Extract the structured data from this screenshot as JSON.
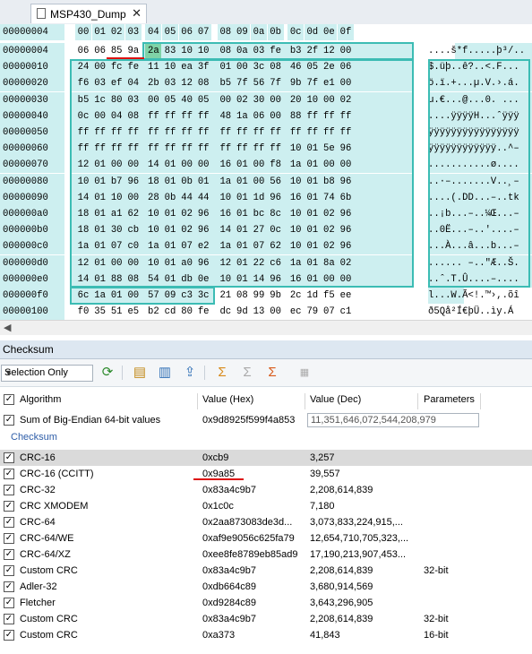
{
  "tab": {
    "title": "MSP430_Dump",
    "close": "✕"
  },
  "hex": {
    "header_offset": "00000004",
    "columns": [
      "00",
      "01",
      "02",
      "03",
      "04",
      "05",
      "06",
      "07",
      "08",
      "09",
      "0a",
      "0b",
      "0c",
      "0d",
      "0e",
      "0f"
    ],
    "rows": [
      {
        "offset": "00000004",
        "bytes": [
          "06",
          "06",
          "85",
          "9a",
          "2a",
          "83",
          "10",
          "10",
          "08",
          "0a",
          "03",
          "fe",
          "b3",
          "2f",
          "12",
          "00"
        ],
        "ascii": "....š*f.....þ³/.."
      },
      {
        "offset": "00000010",
        "bytes": [
          "24",
          "00",
          "fc",
          "fe",
          "11",
          "10",
          "ea",
          "3f",
          "01",
          "00",
          "3c",
          "08",
          "46",
          "05",
          "2e",
          "06"
        ],
        "ascii": "$.üþ..ê?..<.F..."
      },
      {
        "offset": "00000020",
        "bytes": [
          "f6",
          "03",
          "ef",
          "04",
          "2b",
          "03",
          "12",
          "08",
          "b5",
          "7f",
          "56",
          "7f",
          "9b",
          "7f",
          "e1",
          "00"
        ],
        "ascii": "ö.ï.+...µ.V.›.á."
      },
      {
        "offset": "00000030",
        "bytes": [
          "b5",
          "1c",
          "80",
          "03",
          "00",
          "05",
          "40",
          "05",
          "00",
          "02",
          "30",
          "00",
          "20",
          "10",
          "00",
          "02"
        ],
        "ascii": "µ.€...@...0. ..."
      },
      {
        "offset": "00000040",
        "bytes": [
          "0c",
          "00",
          "04",
          "08",
          "ff",
          "ff",
          "ff",
          "ff",
          "48",
          "1a",
          "06",
          "00",
          "88",
          "ff",
          "ff",
          "ff"
        ],
        "ascii": "....ÿÿÿÿH...ˆÿÿÿ"
      },
      {
        "offset": "00000050",
        "bytes": [
          "ff",
          "ff",
          "ff",
          "ff",
          "ff",
          "ff",
          "ff",
          "ff",
          "ff",
          "ff",
          "ff",
          "ff",
          "ff",
          "ff",
          "ff",
          "ff"
        ],
        "ascii": "ÿÿÿÿÿÿÿÿÿÿÿÿÿÿÿÿ"
      },
      {
        "offset": "00000060",
        "bytes": [
          "ff",
          "ff",
          "ff",
          "ff",
          "ff",
          "ff",
          "ff",
          "ff",
          "ff",
          "ff",
          "ff",
          "ff",
          "10",
          "01",
          "5e",
          "96"
        ],
        "ascii": "ÿÿÿÿÿÿÿÿÿÿÿÿ..^–"
      },
      {
        "offset": "00000070",
        "bytes": [
          "12",
          "01",
          "00",
          "00",
          "14",
          "01",
          "00",
          "00",
          "16",
          "01",
          "00",
          "f8",
          "1a",
          "01",
          "00",
          "00"
        ],
        "ascii": "...........ø...."
      },
      {
        "offset": "00000080",
        "bytes": [
          "10",
          "01",
          "b7",
          "96",
          "18",
          "01",
          "0b",
          "01",
          "1a",
          "01",
          "00",
          "56",
          "10",
          "01",
          "b8",
          "96"
        ],
        "ascii": "..·–.......V..¸–"
      },
      {
        "offset": "00000090",
        "bytes": [
          "14",
          "01",
          "10",
          "00",
          "28",
          "0b",
          "44",
          "44",
          "10",
          "01",
          "1d",
          "96",
          "16",
          "01",
          "74",
          "6b"
        ],
        "ascii": "....(.DD...–..tk"
      },
      {
        "offset": "000000a0",
        "bytes": [
          "18",
          "01",
          "a1",
          "62",
          "10",
          "01",
          "02",
          "96",
          "16",
          "01",
          "bc",
          "8c",
          "10",
          "01",
          "02",
          "96"
        ],
        "ascii": "..¡b...–..¼Œ...–"
      },
      {
        "offset": "000000b0",
        "bytes": [
          "18",
          "01",
          "30",
          "cb",
          "10",
          "01",
          "02",
          "96",
          "14",
          "01",
          "27",
          "0c",
          "10",
          "01",
          "02",
          "96"
        ],
        "ascii": "..0Ë...–..'....–"
      },
      {
        "offset": "000000c0",
        "bytes": [
          "1a",
          "01",
          "07",
          "c0",
          "1a",
          "01",
          "07",
          "e2",
          "1a",
          "01",
          "07",
          "62",
          "10",
          "01",
          "02",
          "96"
        ],
        "ascii": "...À...â...b...–"
      },
      {
        "offset": "000000d0",
        "bytes": [
          "12",
          "01",
          "00",
          "00",
          "10",
          "01",
          "a0",
          "96",
          "12",
          "01",
          "22",
          "c6",
          "1a",
          "01",
          "8a",
          "02"
        ],
        "ascii": "...... –..\"Æ..Š."
      },
      {
        "offset": "000000e0",
        "bytes": [
          "14",
          "01",
          "88",
          "08",
          "54",
          "01",
          "db",
          "0e",
          "10",
          "01",
          "14",
          "96",
          "16",
          "01",
          "00",
          "00"
        ],
        "ascii": "..ˆ.T.Û....–...."
      },
      {
        "offset": "000000f0",
        "bytes": [
          "6c",
          "1a",
          "01",
          "00",
          "57",
          "09",
          "c3",
          "3c",
          "21",
          "08",
          "99",
          "9b",
          "2c",
          "1d",
          "f5",
          "ee"
        ],
        "ascii": "l...W.Ã<!.™›,.õî"
      },
      {
        "offset": "00000100",
        "bytes": [
          "f0",
          "35",
          "51",
          "e5",
          "b2",
          "cd",
          "80",
          "fe",
          "dc",
          "9d",
          "13",
          "00",
          "ec",
          "79",
          "07",
          "c1"
        ],
        "ascii": "ð5Qå²Í€þÜ..ìy.Á"
      }
    ]
  },
  "panel": {
    "title": "Checksum",
    "scope_select": "Selection Only",
    "headers": {
      "algorithm": "Algorithm",
      "hex": "Value (Hex)",
      "dec": "Value (Dec)",
      "params": "Parameters"
    },
    "top_row": {
      "algorithm": "Sum of Big-Endian 64-bit values",
      "hex": "0x9d8925f599f4a853",
      "dec": "11,351,646,072,544,208,979"
    },
    "group_label": "Checksum",
    "rows": [
      {
        "algorithm": "CRC-16",
        "hex": "0xcb9",
        "dec": "3,257",
        "params": ""
      },
      {
        "algorithm": "CRC-16 (CCITT)",
        "hex": "0x9a85",
        "dec": "39,557",
        "params": ""
      },
      {
        "algorithm": "CRC-32",
        "hex": "0x83a4c9b7",
        "dec": "2,208,614,839",
        "params": ""
      },
      {
        "algorithm": "CRC XMODEM",
        "hex": "0x1c0c",
        "dec": "7,180",
        "params": ""
      },
      {
        "algorithm": "CRC-64",
        "hex": "0x2aa873083de3d...",
        "dec": "3,073,833,224,915,...",
        "params": ""
      },
      {
        "algorithm": "CRC-64/WE",
        "hex": "0xaf9e9056c625fa79",
        "dec": "12,654,710,705,323,...",
        "params": ""
      },
      {
        "algorithm": "CRC-64/XZ",
        "hex": "0xee8fe8789eb85ad9",
        "dec": "17,190,213,907,453...",
        "params": ""
      },
      {
        "algorithm": "Custom CRC",
        "hex": "0x83a4c9b7",
        "dec": "2,208,614,839",
        "params": "32-bit"
      },
      {
        "algorithm": "Adler-32",
        "hex": "0xdb664c89",
        "dec": "3,680,914,569",
        "params": ""
      },
      {
        "algorithm": "Fletcher",
        "hex": "0xd9284c89",
        "dec": "3,643,296,905",
        "params": ""
      },
      {
        "algorithm": "Custom CRC",
        "hex": "0x83a4c9b7",
        "dec": "2,208,614,839",
        "params": "32-bit"
      },
      {
        "algorithm": "Custom CRC",
        "hex": "0xa373",
        "dec": "41,843",
        "params": "16-bit"
      }
    ]
  },
  "colors": {
    "selection_bg": "#cdeff0",
    "highlight": "#7fd3a7",
    "selection_border": "#3cbcb4",
    "annotation_red": "#d11111",
    "group_text": "#2e5da8"
  }
}
